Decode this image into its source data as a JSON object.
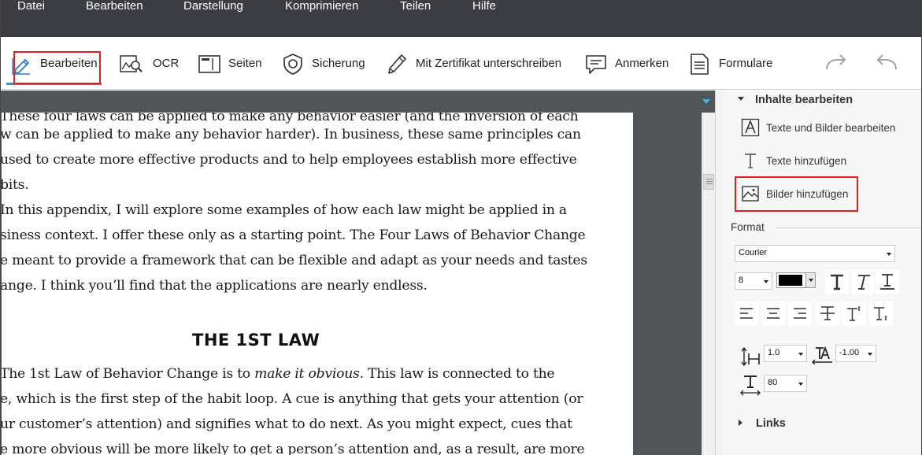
{
  "menubar": {
    "items": [
      "Datei",
      "Bearbeiten",
      "Darstellung",
      "Komprimieren",
      "Teilen",
      "Hilfe"
    ]
  },
  "toolbar": {
    "tools": [
      {
        "label": "Bearbeiten",
        "icon": "edit-pen-icon",
        "active": true
      },
      {
        "label": "OCR",
        "icon": "ocr-scan-icon"
      },
      {
        "label": "Seiten",
        "icon": "pages-icon"
      },
      {
        "label": "Sicherung",
        "icon": "shield-icon"
      },
      {
        "label": "Mit Zertifikat unterschreiben",
        "icon": "sign-pen-icon"
      },
      {
        "label": "Anmerken",
        "icon": "comment-icon"
      },
      {
        "label": "Formulare",
        "icon": "form-document-icon"
      }
    ],
    "redo_icon": "redo-icon",
    "undo_icon": "undo-icon"
  },
  "document": {
    "lines": [
      "These four laws can be applied to make any behavior easier (and the inversion of each",
      "w can be applied to make any behavior harder). In business, these same principles can",
      " used to create more effective products and to help employees establish more effective",
      "bits.",
      "  In this appendix, I will explore some examples of how each law might be applied in a",
      "siness context. I offer these only as a starting point. The Four Laws of Behavior Change",
      "e meant to provide a framework that can be flexible and adapt as your needs and tastes",
      "ange. I think you’ll find that the applications are nearly endless."
    ],
    "heading": "THE 1ST LAW",
    "lines2": [
      {
        "pre": "  The 1st Law of Behavior Change is to ",
        "em": "make it obvious",
        "post": ". This law is connected to the"
      },
      {
        "pre": "e, which is the first step of the habit loop. A cue is anything that gets your attention (or",
        "em": "",
        "post": ""
      },
      {
        "pre": "ur customer’s attention) and signifies what to do next. As you might expect, cues that",
        "em": "",
        "post": ""
      },
      {
        "pre": "e more obvious will be more likely to get a person’s attention and, as a result, are more",
        "em": "",
        "post": ""
      }
    ]
  },
  "sidepanel": {
    "section_content": "Inhalte bearbeiten",
    "items": [
      {
        "label": "Texte und Bilder bearbeiten",
        "icon": "edit-text-images-icon"
      },
      {
        "label": "Texte hinzufügen",
        "icon": "add-text-icon"
      },
      {
        "label": "Bilder hinzufügen",
        "icon": "add-image-icon"
      }
    ],
    "format_label": "Format",
    "font_value": "Courier",
    "size_value": "8",
    "color_value": "#000000",
    "line_spacing_value": "1.0",
    "char_spacing_value": "-1.00",
    "scale_value": "80",
    "section_links": "Links"
  },
  "accent": {
    "highlight": "#e0201f",
    "active_tab": "#2b95d6"
  }
}
